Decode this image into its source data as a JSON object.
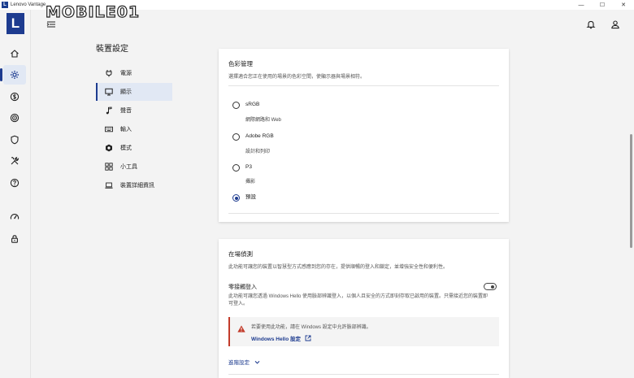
{
  "window": {
    "title": "Lenovo Vantage",
    "app_icon_letter": "L",
    "minimize": "—",
    "maximize": "☐",
    "close": "✕"
  },
  "watermark": "MOBILE01",
  "rail": {
    "logo": "L",
    "items": [
      {
        "icon": "home-icon",
        "active": false
      },
      {
        "icon": "gear-icon",
        "active": true
      },
      {
        "icon": "dollar-icon",
        "active": false
      },
      {
        "icon": "radar-icon",
        "active": false
      },
      {
        "icon": "shield-icon",
        "active": false
      },
      {
        "icon": "tools-icon",
        "active": false
      },
      {
        "icon": "help-icon",
        "active": false
      },
      {
        "icon": "speedometer-icon",
        "active": false
      },
      {
        "icon": "lock-icon",
        "active": false
      }
    ]
  },
  "settings": {
    "page_title": "裝置設定",
    "nav": [
      {
        "label": "電源",
        "icon": "plug-icon"
      },
      {
        "label": "顯示",
        "icon": "monitor-icon",
        "active": true
      },
      {
        "label": "聲音",
        "icon": "music-note-icon"
      },
      {
        "label": "輸入",
        "icon": "keyboard-icon"
      },
      {
        "label": "模式",
        "icon": "hexagon-icon"
      },
      {
        "label": "小工具",
        "icon": "widgets-icon"
      },
      {
        "label": "裝置詳細資訊",
        "icon": "laptop-icon"
      }
    ]
  },
  "color_management": {
    "title": "色彩管理",
    "description": "選擇適合您正在使用的場景的色彩空間，使顯示器與場景相符。",
    "options": [
      {
        "label": "sRGB",
        "sub": "網際網路和 Web",
        "checked": false
      },
      {
        "label": "Adobe RGB",
        "sub": "設計和列印",
        "checked": false
      },
      {
        "label": "P3",
        "sub": "攝影",
        "checked": false
      },
      {
        "label": "預設",
        "sub": "",
        "checked": true
      }
    ]
  },
  "presence": {
    "title": "在場偵測",
    "description": "此功能可讓您的裝置以智慧型方式感應到您的存在，提供順暢的登入和鎖定，並增強安全性和便利性。",
    "zero_touch": {
      "title": "零接觸登入",
      "description": "此功能可讓您透過 Windows Hello 使用臉部辨識登入，以個人且安全的方式即刻存取已啟用的裝置。只需接近您的裝置即可登入。",
      "enabled": false
    },
    "warning": {
      "text": "若要使用此功能，請在 Windows 設定中允許臉部辨識。",
      "link": "Windows Hello 設定"
    },
    "advanced": "進階設定"
  },
  "colors": {
    "accent": "#1d3b8f",
    "warning": "#c23b2a"
  }
}
